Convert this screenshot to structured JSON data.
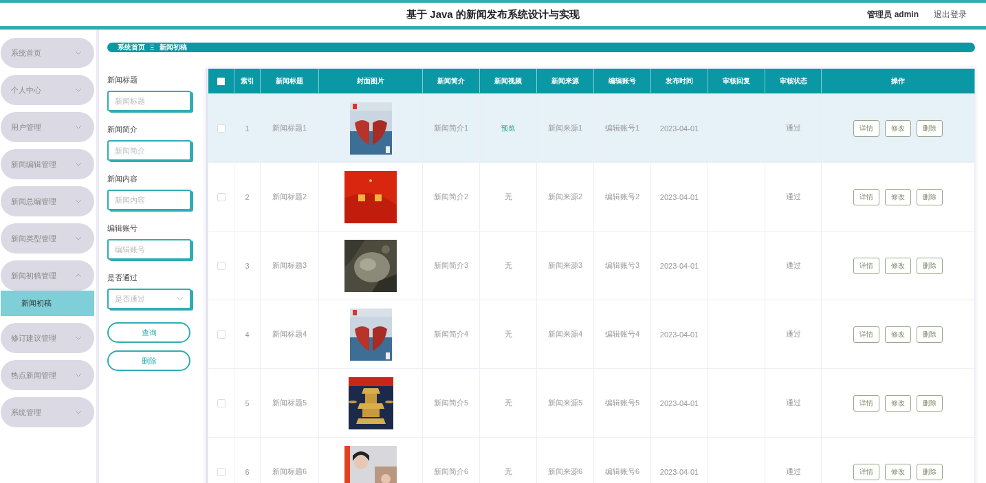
{
  "header": {
    "title": "基于 Java 的新闻发布系统设计与实现",
    "user": "管理员 admin",
    "logout": "退出登录"
  },
  "sidebar": {
    "items": [
      {
        "label": "系统首页",
        "expanded": false
      },
      {
        "label": "个人中心",
        "expanded": false
      },
      {
        "label": "用户管理",
        "expanded": false
      },
      {
        "label": "新闻编辑管理",
        "expanded": false
      },
      {
        "label": "新闻总编管理",
        "expanded": false
      },
      {
        "label": "新闻类型管理",
        "expanded": false
      },
      {
        "label": "新闻初稿管理",
        "expanded": true,
        "children": [
          {
            "label": "新闻初稿",
            "selected": true
          }
        ]
      },
      {
        "label": "修订建议管理",
        "expanded": false
      },
      {
        "label": "热点新闻管理",
        "expanded": false
      },
      {
        "label": "系统管理",
        "expanded": false
      }
    ]
  },
  "breadcrumb": {
    "home": "系统首页",
    "separator": "Ξ",
    "current": "新闻初稿"
  },
  "filters": {
    "fields": [
      {
        "label": "新闻标题",
        "placeholder": "新闻标题",
        "kind": "text"
      },
      {
        "label": "新闻简介",
        "placeholder": "新闻简介",
        "kind": "text"
      },
      {
        "label": "新闻内容",
        "placeholder": "新闻内容",
        "kind": "text"
      },
      {
        "label": "编辑账号",
        "placeholder": "编辑账号",
        "kind": "text"
      },
      {
        "label": "是否通过",
        "placeholder": "是否通过",
        "kind": "select"
      }
    ],
    "buttons": [
      "查询",
      "删除"
    ]
  },
  "table": {
    "header_checkbox": {
      "checked": false
    },
    "columns": [
      "索引",
      "新闻标题",
      "封面图片",
      "新闻简介",
      "新闻视频",
      "新闻来源",
      "编辑账号",
      "发布时间",
      "审核回复",
      "审核状态",
      "操作"
    ],
    "rows": [
      {
        "checked": false,
        "index": "1",
        "title": "新闻标题1",
        "intro": "新闻简介1",
        "video": {
          "text": "预览",
          "kind": "link"
        },
        "source": "新闻来源1",
        "account": "编辑账号1",
        "time": "2023-04-01",
        "status": "通过",
        "hover": true,
        "actions": [
          "详情",
          "修改",
          "删除"
        ]
      },
      {
        "checked": false,
        "index": "2",
        "title": "新闻标题2",
        "intro": "新闻简介2",
        "video": {
          "text": "无",
          "kind": "none"
        },
        "source": "新闻来源2",
        "account": "编辑账号2",
        "time": "2023-04-01",
        "status": "通过",
        "hover": false,
        "actions": [
          "详情",
          "修改",
          "删除"
        ]
      },
      {
        "checked": false,
        "index": "3",
        "title": "新闻标题3",
        "intro": "新闻简介3",
        "video": {
          "text": "无",
          "kind": "none"
        },
        "source": "新闻来源3",
        "account": "编辑账号3",
        "time": "2023-04-01",
        "status": "通过",
        "hover": false,
        "actions": [
          "详情",
          "修改",
          "删除"
        ]
      },
      {
        "checked": false,
        "index": "4",
        "title": "新闻标题4",
        "intro": "新闻简介4",
        "video": {
          "text": "无",
          "kind": "none"
        },
        "source": "新闻来源4",
        "account": "编辑账号4",
        "time": "2023-04-01",
        "status": "通过",
        "hover": false,
        "actions": [
          "详情",
          "修改",
          "删除"
        ]
      },
      {
        "checked": false,
        "index": "5",
        "title": "新闻标题5",
        "intro": "新闻简介5",
        "video": {
          "text": "无",
          "kind": "none"
        },
        "source": "新闻来源5",
        "account": "编辑账号5",
        "time": "2023-04-01",
        "status": "通过",
        "hover": false,
        "actions": [
          "详情",
          "修改",
          "删除"
        ]
      },
      {
        "checked": false,
        "index": "6",
        "title": "新闻标题6",
        "intro": "新闻简介6",
        "video": {
          "text": "无",
          "kind": "none"
        },
        "source": "新闻来源6",
        "account": "编辑账号6",
        "time": "2023-04-01",
        "status": "通过",
        "hover": false,
        "actions": [
          "详情",
          "修改",
          "删除"
        ]
      }
    ]
  }
}
